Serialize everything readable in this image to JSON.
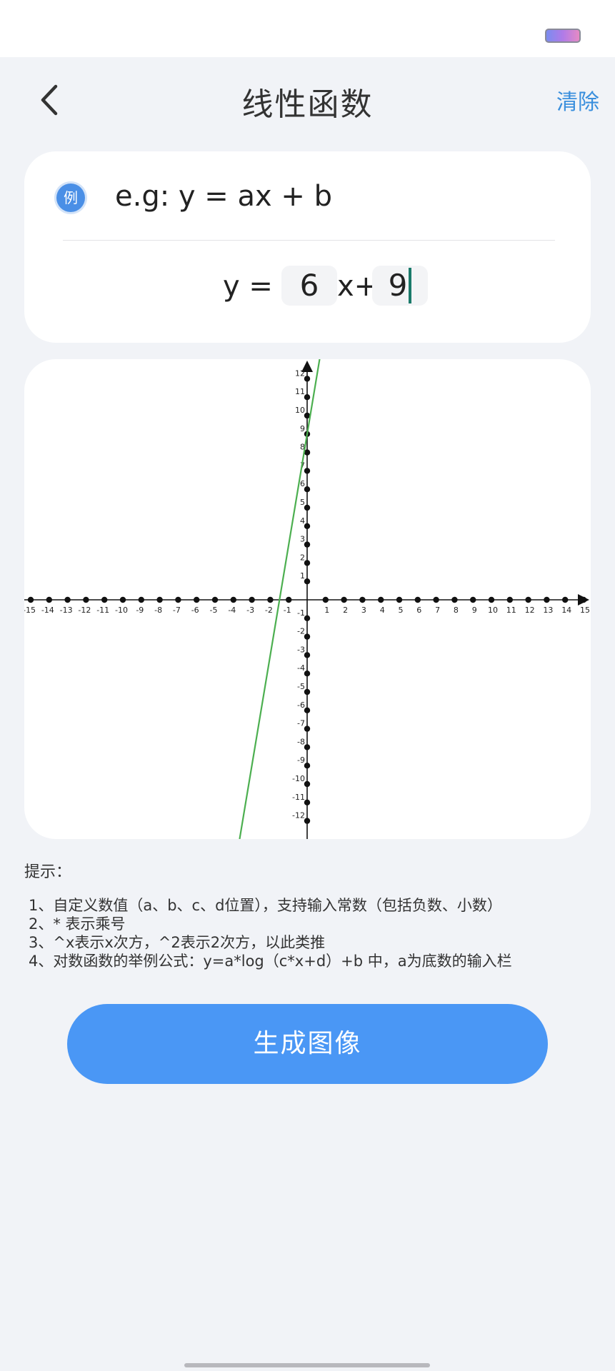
{
  "header": {
    "title": "线性函数",
    "clear_label": "清除"
  },
  "example": {
    "icon_label": "例",
    "text": "e.g: y = ax + b"
  },
  "formula": {
    "prefix": "y =",
    "a_value": "6",
    "middle": "x+",
    "b_value": "9"
  },
  "chart_data": {
    "type": "line",
    "equation": {
      "slope": 6,
      "intercept": 9
    },
    "xlim": [
      -15,
      15
    ],
    "ylim": [
      -12,
      12
    ],
    "x_ticks": [
      -15,
      -14,
      -13,
      -12,
      -11,
      -10,
      -9,
      -8,
      -7,
      -6,
      -5,
      -4,
      -3,
      -2,
      -1,
      1,
      2,
      3,
      4,
      5,
      6,
      7,
      8,
      9,
      10,
      11,
      12,
      13,
      14,
      15
    ],
    "y_ticks": [
      -12,
      -11,
      -10,
      -9,
      -8,
      -7,
      -6,
      -5,
      -4,
      -3,
      -2,
      -1,
      1,
      2,
      3,
      4,
      5,
      6,
      7,
      8,
      9,
      10,
      11,
      12
    ],
    "line_color": "#4caf50",
    "axis_color": "#111111"
  },
  "hints": {
    "title": "提示：",
    "items": [
      "1、自定义数值（a、b、c、d位置），支持输入常数（包括负数、小数）",
      "2、* 表示乘号",
      "3、^x表示x次方，^2表示2次方，以此类推",
      "4、对数函数的举例公式：y=a*log（c*x+d）+b 中，a为底数的输入栏"
    ]
  },
  "generate_button": {
    "label": "生成图像"
  },
  "colors": {
    "accent": "#4a97f5",
    "link": "#3a8fdd"
  }
}
